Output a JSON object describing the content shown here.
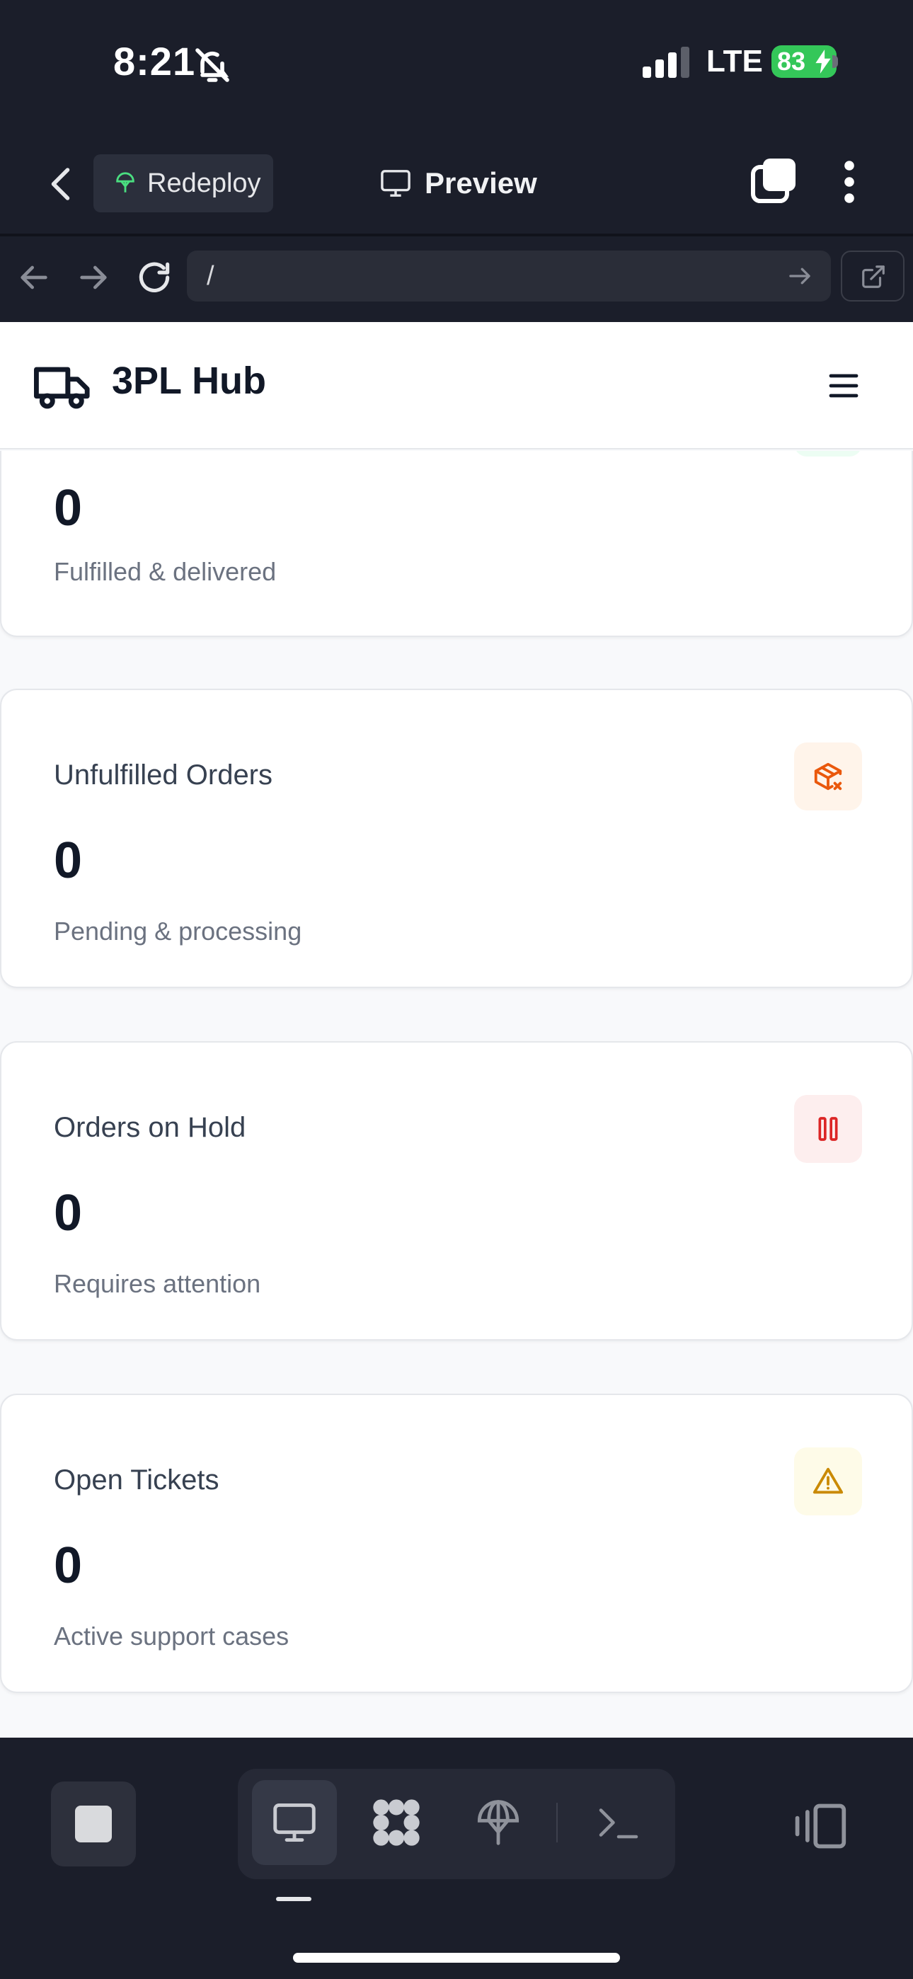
{
  "status_bar": {
    "time": "8:21",
    "network": "LTE",
    "battery": "83"
  },
  "browser": {
    "deploy_label": "Redeploy",
    "preview_label": "Preview",
    "url": "/"
  },
  "app": {
    "title": "3PL Hub"
  },
  "cards": [
    {
      "title": "",
      "value": "0",
      "description": "Fulfilled & delivered",
      "icon": "check-icon"
    },
    {
      "title": "Unfulfilled Orders",
      "value": "0",
      "description": "Pending & processing",
      "icon": "package-x-icon",
      "icon_color": "#ea580c",
      "icon_bg": "#fff4ea"
    },
    {
      "title": "Orders on Hold",
      "value": "0",
      "description": "Requires attention",
      "icon": "pause-icon",
      "icon_color": "#dc2626",
      "icon_bg": "#fdeeee"
    },
    {
      "title": "Open Tickets",
      "value": "0",
      "description": "Active support cases",
      "icon": "alert-triangle-icon",
      "icon_color": "#ca8a04",
      "icon_bg": "#fefbe8"
    }
  ],
  "bottom_bar": {
    "tools": [
      "desktop-icon",
      "apps-icon",
      "deploy-icon",
      "terminal-icon"
    ]
  }
}
